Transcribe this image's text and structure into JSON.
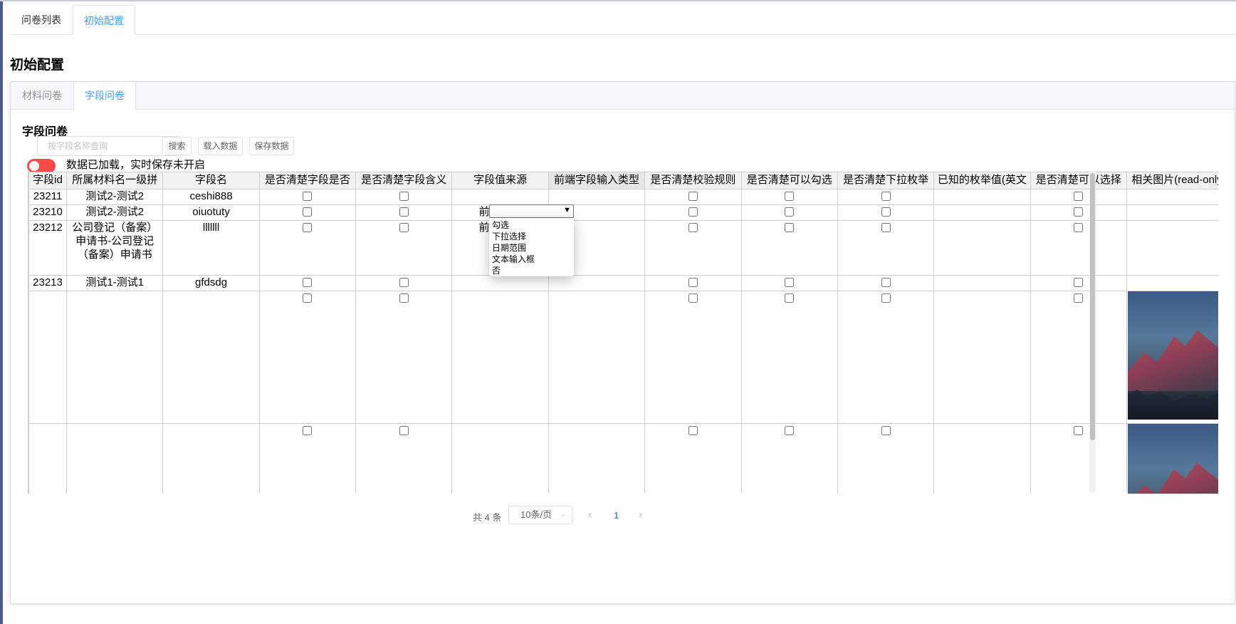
{
  "top_tabs": [
    {
      "label": "问卷列表",
      "active": false
    },
    {
      "label": "初始配置",
      "active": true
    }
  ],
  "page_title": "初始配置",
  "inner_tabs": [
    {
      "label": "材料问卷",
      "active": false
    },
    {
      "label": "字段问卷",
      "active": true
    }
  ],
  "section_title": "字段问卷",
  "search": {
    "placeholder": "按字段名称查询",
    "value": ""
  },
  "buttons": {
    "search": "搜索",
    "load": "载入数据",
    "save": "保存数据"
  },
  "realtime_toggle": {
    "on": false,
    "status": "数据已加载，实时保存未开启"
  },
  "table": {
    "columns": [
      "字段id",
      "所属材料名一级拼",
      "字段名",
      "是否清楚字段是否",
      "是否清楚字段含义",
      "字段值来源",
      "前端字段输入类型",
      "是否清楚校验规则",
      "是否清楚可以勾选",
      "是否清楚下拉枚举",
      "已知的枚举值(英文",
      "是否清楚可以选择",
      "相关图片(read-only"
    ],
    "rows": [
      {
        "id": "23211",
        "material": "测试2-测试2",
        "field": "ceshi888",
        "source": ""
      },
      {
        "id": "23210",
        "material": "测试2-测试2",
        "field": "oiuotuty",
        "source": "前端字段"
      },
      {
        "id": "23212",
        "material": "公司登记（备案）申请书-公司登记（备案）申请书",
        "field": "lllllll",
        "source": "前端字段"
      },
      {
        "id": "23213",
        "material": "测试1-测试1",
        "field": "gfdsdg",
        "source": ""
      },
      {
        "id": "",
        "material": "",
        "field": "",
        "source": "",
        "image": "mountain-photo"
      },
      {
        "id": "",
        "material": "",
        "field": "",
        "source": "",
        "image": "mountain-photo"
      }
    ]
  },
  "input_type_dropdown": {
    "selected": "",
    "options": [
      "勾选",
      "下拉选择",
      "日期范围",
      "文本输入框",
      "否"
    ]
  },
  "pagination": {
    "total": "共 4 条",
    "page_size": "10条/页",
    "prev_icon": "‹",
    "next_icon": "›",
    "current_page": "1"
  },
  "colors": {
    "accent": "#409eff",
    "toggle_off": "#ff4949"
  }
}
